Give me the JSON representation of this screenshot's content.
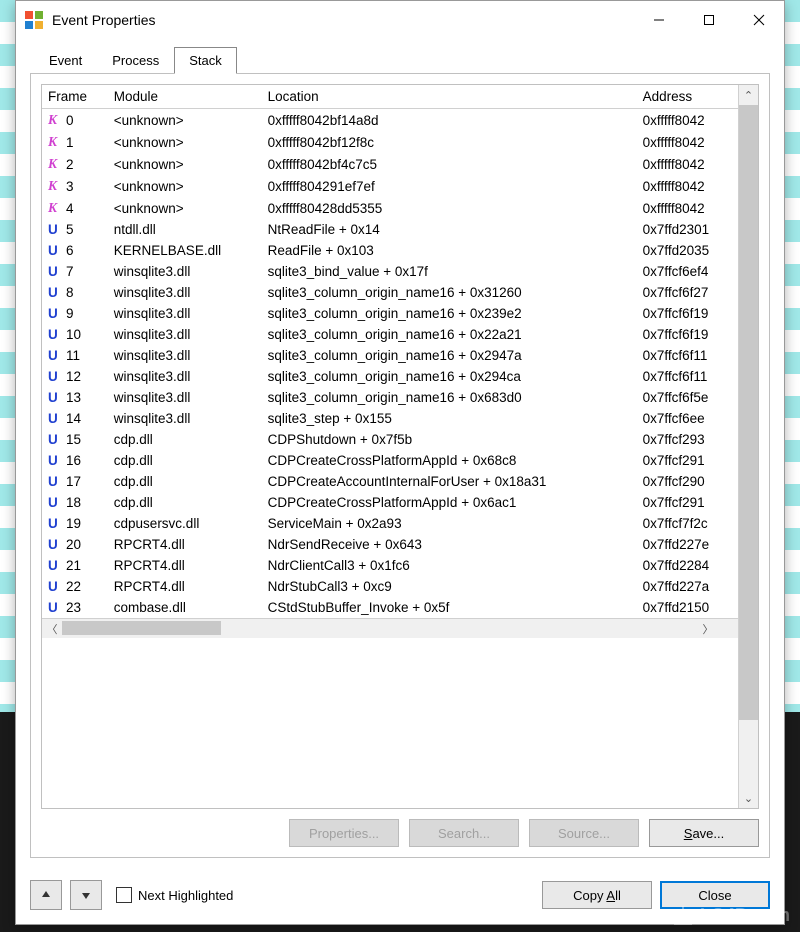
{
  "window": {
    "title": "Event Properties"
  },
  "tabs": [
    {
      "label": "Event",
      "active": false
    },
    {
      "label": "Process",
      "active": false
    },
    {
      "label": "Stack",
      "active": true
    }
  ],
  "columns": [
    "Frame",
    "Module",
    "Location",
    "Address"
  ],
  "rows": [
    {
      "icon": "K",
      "frame": "0",
      "module": "<unknown>",
      "location": "0xfffff8042bf14a8d",
      "address": "0xfffff8042"
    },
    {
      "icon": "K",
      "frame": "1",
      "module": "<unknown>",
      "location": "0xfffff8042bf12f8c",
      "address": "0xfffff8042"
    },
    {
      "icon": "K",
      "frame": "2",
      "module": "<unknown>",
      "location": "0xfffff8042bf4c7c5",
      "address": "0xfffff8042"
    },
    {
      "icon": "K",
      "frame": "3",
      "module": "<unknown>",
      "location": "0xfffff804291ef7ef",
      "address": "0xfffff8042"
    },
    {
      "icon": "K",
      "frame": "4",
      "module": "<unknown>",
      "location": "0xfffff80428dd5355",
      "address": "0xfffff8042"
    },
    {
      "icon": "U",
      "frame": "5",
      "module": "ntdll.dll",
      "location": "NtReadFile + 0x14",
      "address": "0x7ffd2301"
    },
    {
      "icon": "U",
      "frame": "6",
      "module": "KERNELBASE.dll",
      "location": "ReadFile + 0x103",
      "address": "0x7ffd2035"
    },
    {
      "icon": "U",
      "frame": "7",
      "module": "winsqlite3.dll",
      "location": "sqlite3_bind_value + 0x17f",
      "address": "0x7ffcf6ef4"
    },
    {
      "icon": "U",
      "frame": "8",
      "module": "winsqlite3.dll",
      "location": "sqlite3_column_origin_name16 + 0x31260",
      "address": "0x7ffcf6f27"
    },
    {
      "icon": "U",
      "frame": "9",
      "module": "winsqlite3.dll",
      "location": "sqlite3_column_origin_name16 + 0x239e2",
      "address": "0x7ffcf6f19"
    },
    {
      "icon": "U",
      "frame": "10",
      "module": "winsqlite3.dll",
      "location": "sqlite3_column_origin_name16 + 0x22a21",
      "address": "0x7ffcf6f19"
    },
    {
      "icon": "U",
      "frame": "11",
      "module": "winsqlite3.dll",
      "location": "sqlite3_column_origin_name16 + 0x2947a",
      "address": "0x7ffcf6f11"
    },
    {
      "icon": "U",
      "frame": "12",
      "module": "winsqlite3.dll",
      "location": "sqlite3_column_origin_name16 + 0x294ca",
      "address": "0x7ffcf6f11"
    },
    {
      "icon": "U",
      "frame": "13",
      "module": "winsqlite3.dll",
      "location": "sqlite3_column_origin_name16 + 0x683d0",
      "address": "0x7ffcf6f5e"
    },
    {
      "icon": "U",
      "frame": "14",
      "module": "winsqlite3.dll",
      "location": "sqlite3_step + 0x155",
      "address": "0x7ffcf6ee"
    },
    {
      "icon": "U",
      "frame": "15",
      "module": "cdp.dll",
      "location": "CDPShutdown + 0x7f5b",
      "address": "0x7ffcf293"
    },
    {
      "icon": "U",
      "frame": "16",
      "module": "cdp.dll",
      "location": "CDPCreateCrossPlatformAppId + 0x68c8",
      "address": "0x7ffcf291"
    },
    {
      "icon": "U",
      "frame": "17",
      "module": "cdp.dll",
      "location": "CDPCreateAccountInternalForUser + 0x18a31",
      "address": "0x7ffcf290"
    },
    {
      "icon": "U",
      "frame": "18",
      "module": "cdp.dll",
      "location": "CDPCreateCrossPlatformAppId + 0x6ac1",
      "address": "0x7ffcf291"
    },
    {
      "icon": "U",
      "frame": "19",
      "module": "cdpusersvc.dll",
      "location": "ServiceMain + 0x2a93",
      "address": "0x7ffcf7f2c"
    },
    {
      "icon": "U",
      "frame": "20",
      "module": "RPCRT4.dll",
      "location": "NdrSendReceive + 0x643",
      "address": "0x7ffd227e"
    },
    {
      "icon": "U",
      "frame": "21",
      "module": "RPCRT4.dll",
      "location": "NdrClientCall3 + 0x1fc6",
      "address": "0x7ffd2284"
    },
    {
      "icon": "U",
      "frame": "22",
      "module": "RPCRT4.dll",
      "location": "NdrStubCall3 + 0xc9",
      "address": "0x7ffd227a"
    },
    {
      "icon": "U",
      "frame": "23",
      "module": "combase.dll",
      "location": "CStdStubBuffer_Invoke + 0x5f",
      "address": "0x7ffd2150"
    }
  ],
  "buttons": {
    "properties": "Properties...",
    "search": "Search...",
    "source": "Source...",
    "save": "Save...",
    "save_mn": "S"
  },
  "footer": {
    "next_highlighted": "Next Highlighted",
    "copy_all": "Copy All",
    "copy_all_mn": "A",
    "close": "Close"
  },
  "watermark": "LO4D.com"
}
